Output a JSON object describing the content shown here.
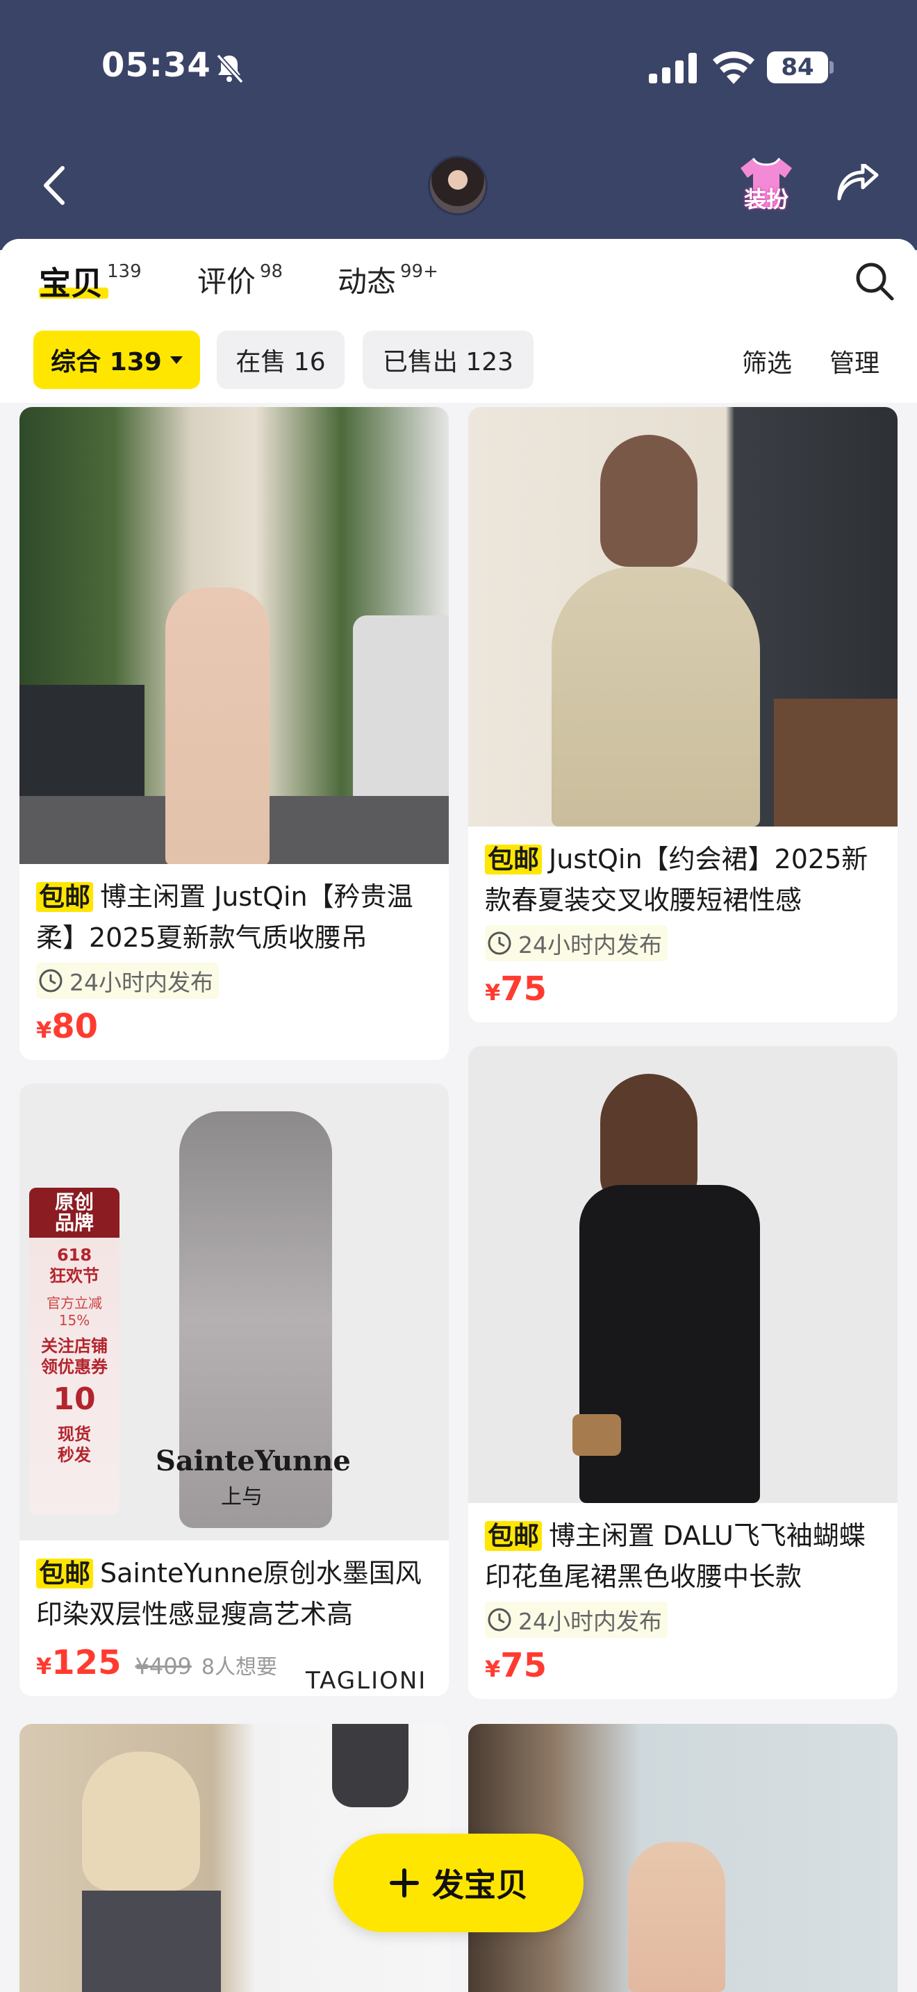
{
  "status_bar": {
    "time": "05:34",
    "battery": "84"
  },
  "header": {
    "costume_label": "装扮"
  },
  "tabs": [
    {
      "label": "宝贝",
      "count": "139"
    },
    {
      "label": "评价",
      "count": "98"
    },
    {
      "label": "动态",
      "count": "99+"
    }
  ],
  "filters": {
    "chips": [
      {
        "label": "综合 139"
      },
      {
        "label": "在售 16"
      },
      {
        "label": "已售出 123"
      }
    ],
    "filter_label": "筛选",
    "manage_label": "管理"
  },
  "products": [
    {
      "badge": "包邮",
      "title": "博主闲置 JustQin【矜贵温柔】2025夏新款气质收腰吊",
      "time_tag": "24小时内发布",
      "currency": "¥",
      "price": "80"
    },
    {
      "badge": "包邮",
      "title": "JustQin【约会裙】2025新款春夏装交叉收腰短裙性感",
      "time_tag": "24小时内发布",
      "currency": "¥",
      "price": "75"
    },
    {
      "badge": "包邮",
      "title": "SainteYunne原创水墨国风印染双层性感显瘦高艺术高",
      "currency": "¥",
      "price": "125",
      "original_price": "¥409",
      "wants": "8人想要",
      "image_text": {
        "promo_head": "原创\n品牌",
        "promo_event": "618\n狂欢节",
        "promo_discount": "官方立减\n15%",
        "promo_coupon": "关注店铺\n领优惠券",
        "promo_amount": "10",
        "promo_stock": "现货\n秒发",
        "brand": "SainteYunne",
        "brand_sub": "上与"
      }
    },
    {
      "badge": "包邮",
      "title": "博主闲置 DALU飞飞袖蝴蝶印花鱼尾裙黑色收腰中长款",
      "time_tag": "24小时内发布",
      "currency": "¥",
      "price": "75"
    },
    {
      "image_text": {
        "brand": "TAGLIONI"
      }
    }
  ],
  "fab": {
    "label": "发宝贝"
  },
  "colors": {
    "header_bg": "#3a4467",
    "accent_yellow": "#ffe600",
    "price_red": "#ff3b30"
  }
}
